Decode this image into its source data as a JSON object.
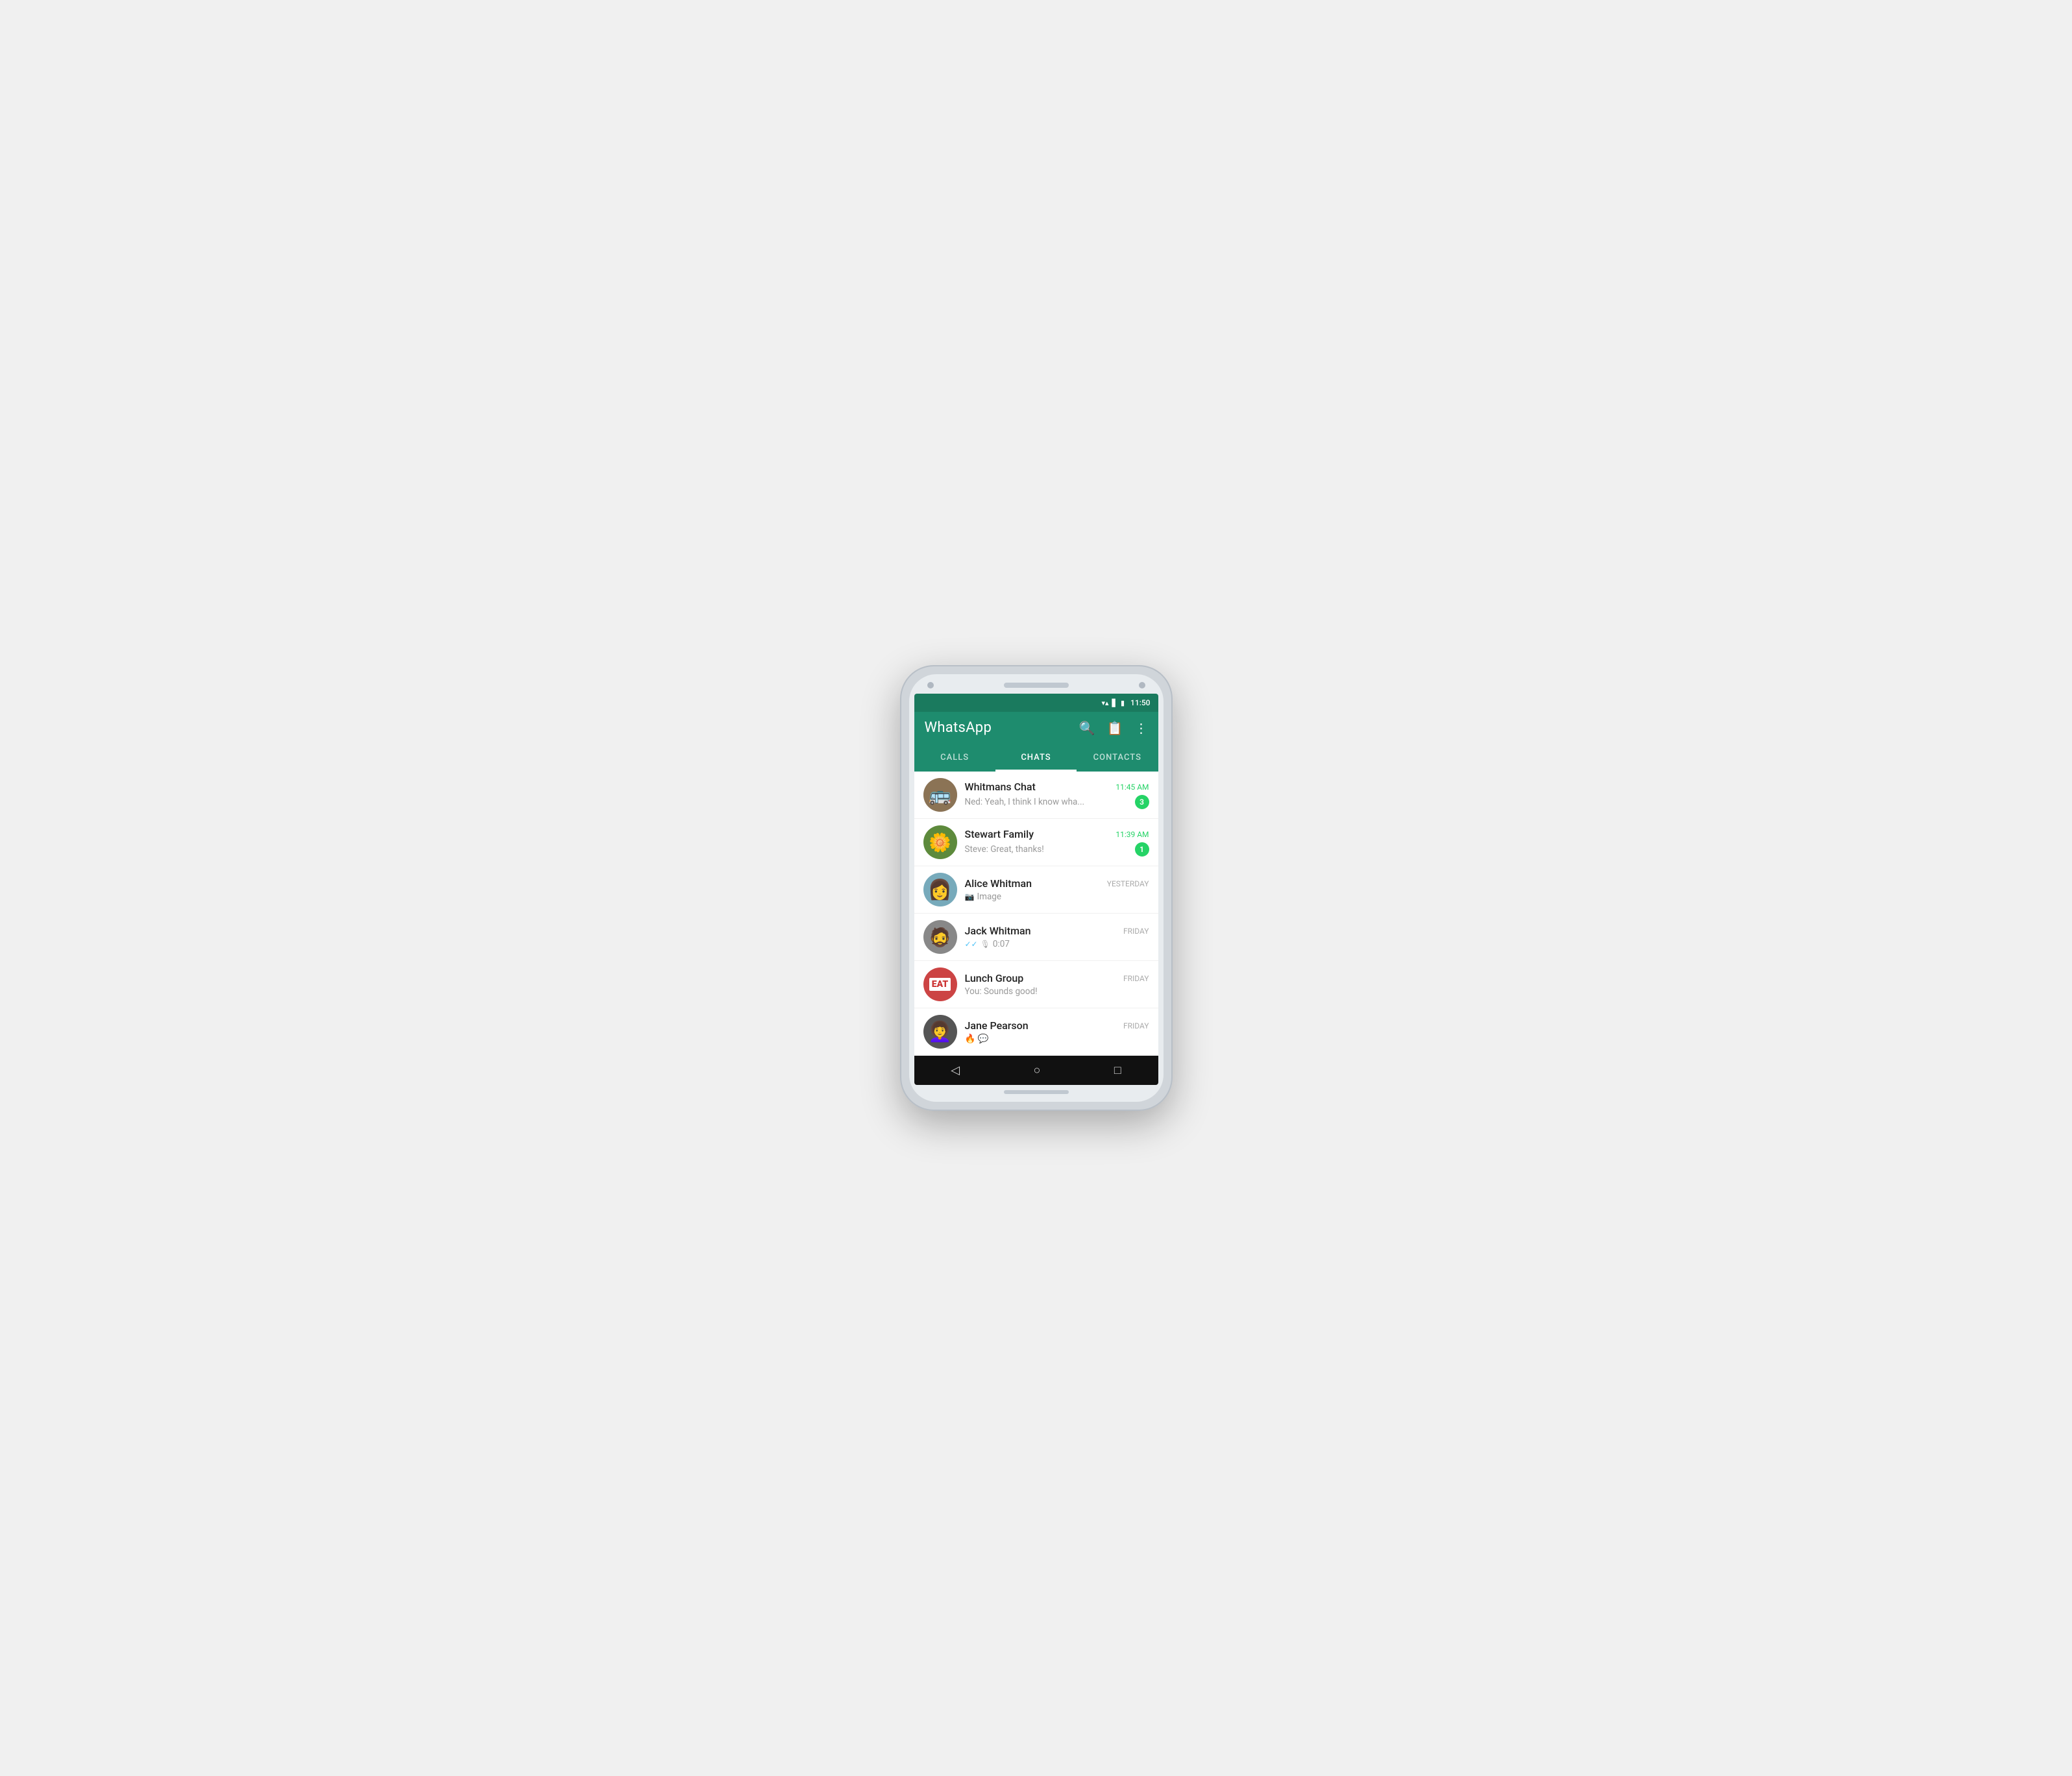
{
  "app": {
    "title": "WhatsApp",
    "status_time": "11:50"
  },
  "tabs": {
    "calls": "CALLS",
    "chats": "CHATS",
    "contacts": "CONTACTS",
    "active": "chats"
  },
  "chats": [
    {
      "id": "whitmans",
      "name": "Whitmans Chat",
      "time": "11:45 AM",
      "time_type": "green",
      "preview": "Ned: Yeah, I think I know wha...",
      "unread": "3",
      "avatar_type": "whitmans"
    },
    {
      "id": "stewart",
      "name": "Stewart Family",
      "time": "11:39 AM",
      "time_type": "green",
      "preview": "Steve: Great, thanks!",
      "unread": "1",
      "avatar_type": "stewart"
    },
    {
      "id": "alice",
      "name": "Alice Whitman",
      "time": "YESTERDAY",
      "time_type": "regular",
      "preview": "Image",
      "preview_icon": "camera",
      "unread": "",
      "avatar_type": "alice"
    },
    {
      "id": "jack",
      "name": "Jack Whitman",
      "time": "FRIDAY",
      "time_type": "regular",
      "preview": "0:07",
      "preview_icon": "mic",
      "preview_check": true,
      "unread": "",
      "avatar_type": "jack"
    },
    {
      "id": "lunch",
      "name": "Lunch Group",
      "time": "FRIDAY",
      "time_type": "regular",
      "preview": "You: Sounds good!",
      "unread": "",
      "avatar_type": "lunch"
    },
    {
      "id": "jane",
      "name": "Jane Pearson",
      "time": "FRIDAY",
      "time_type": "regular",
      "preview": "🔥 💬",
      "unread": "",
      "avatar_type": "jane"
    }
  ],
  "nav": {
    "back": "◁",
    "home": "○",
    "recent": "□"
  }
}
